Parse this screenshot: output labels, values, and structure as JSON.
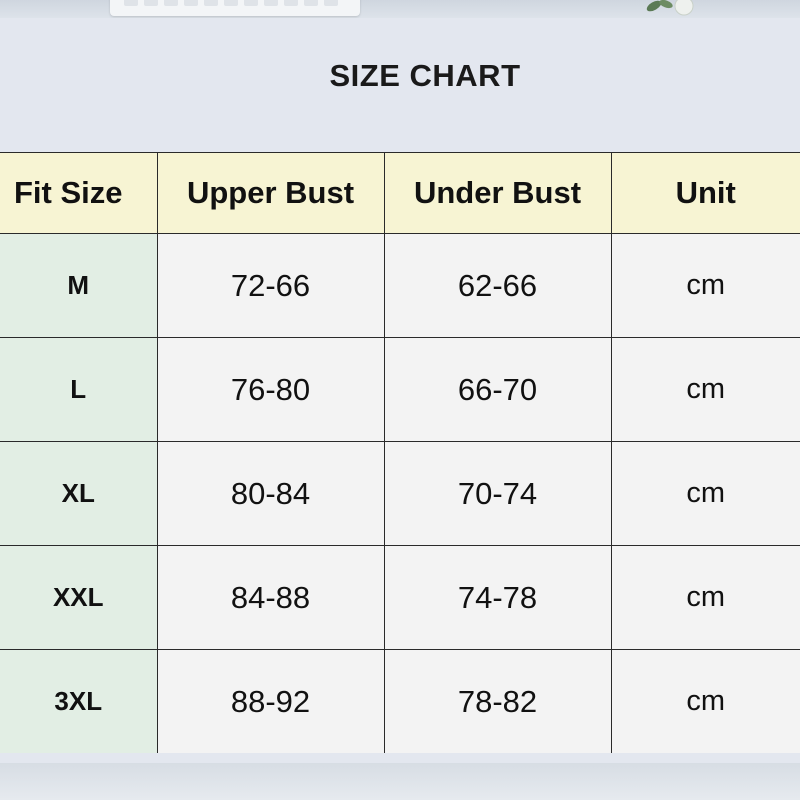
{
  "title": "SIZE CHART",
  "table": {
    "headers": [
      "Fit Size",
      "Upper Bust",
      "Under Bust",
      "Unit"
    ],
    "rows": [
      {
        "size": "M",
        "upper_bust": "72-66",
        "under_bust": "62-66",
        "unit": "cm"
      },
      {
        "size": "L",
        "upper_bust": "76-80",
        "under_bust": "66-70",
        "unit": "cm"
      },
      {
        "size": "XL",
        "upper_bust": "80-84",
        "under_bust": "70-74",
        "unit": "cm"
      },
      {
        "size": "XXL",
        "upper_bust": "84-88",
        "under_bust": "74-78",
        "unit": "cm"
      },
      {
        "size": "3XL",
        "upper_bust": "88-92",
        "under_bust": "78-82",
        "unit": "cm"
      }
    ]
  },
  "colors": {
    "header_bg": "#f7f4d3",
    "size_column_bg": "#e2eee4",
    "cell_bg": "#f3f3f3",
    "card_bg": "#e3e7ef",
    "border": "#2a2a2a"
  }
}
